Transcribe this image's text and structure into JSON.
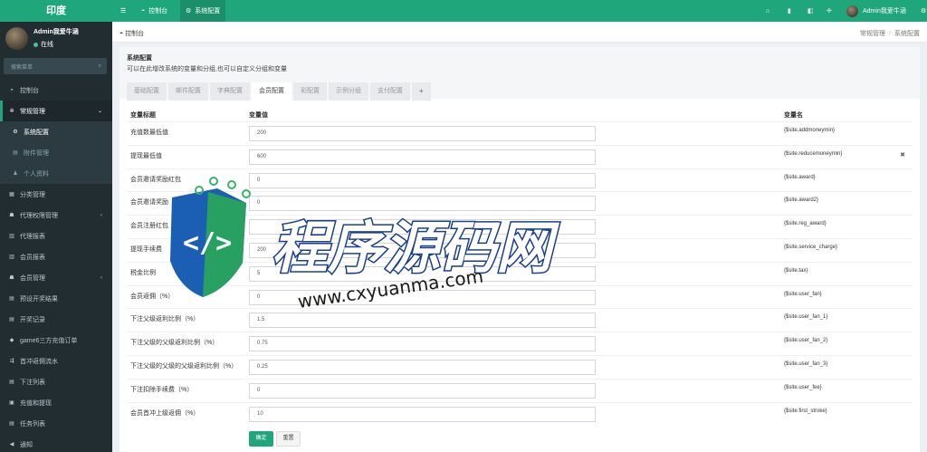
{
  "app": {
    "logo": "印度"
  },
  "user": {
    "name": "Admin我爱牛涵",
    "status": "在线"
  },
  "sidebar": {
    "search_placeholder": "搜索菜单",
    "items": [
      {
        "label": "控制台",
        "icon": "dashboard-icon"
      },
      {
        "label": "常规管理",
        "icon": "cogs-icon"
      },
      {
        "label": "系统配置",
        "icon": "gear-icon"
      },
      {
        "label": "附件管理",
        "icon": "file-icon"
      },
      {
        "label": "个人资料",
        "icon": "user-icon"
      },
      {
        "label": "分类管理",
        "icon": "list-icon"
      },
      {
        "label": "代理权限管理",
        "icon": "group-icon"
      },
      {
        "label": "代理报表",
        "icon": "report-icon"
      },
      {
        "label": "会员报表",
        "icon": "report-icon"
      },
      {
        "label": "会员管理",
        "icon": "users-icon"
      },
      {
        "label": "预设开奖结果",
        "icon": "list-icon"
      },
      {
        "label": "开奖记录",
        "icon": "list-icon"
      },
      {
        "label": "game6三方充值订单",
        "icon": "diamond-icon"
      },
      {
        "label": "首冲返佣流水",
        "icon": "flow-icon"
      },
      {
        "label": "下注列表",
        "icon": "list-icon"
      },
      {
        "label": "充值和提现",
        "icon": "money-icon"
      },
      {
        "label": "任务列表",
        "icon": "list-icon"
      },
      {
        "label": "通知",
        "icon": "bullhorn-icon"
      }
    ]
  },
  "header": {
    "menu_icon": "menu-icon",
    "tabs": [
      {
        "label": "控制台",
        "icon": "dashboard-icon"
      },
      {
        "label": "系统配置",
        "icon": "gear-icon"
      }
    ],
    "user_name": "Admin我爱牛涵"
  },
  "breadcrumb": {
    "left": "控制台",
    "right": [
      "常规管理",
      "系统配置"
    ]
  },
  "panel": {
    "title": "系统配置",
    "description": "可以在此增改系统的变量和分组,也可以自定义分组和变量",
    "tabs": [
      "基础配置",
      "邮件配置",
      "字典配置",
      "会员配置",
      "彩配置",
      "示例分组",
      "支付配置",
      "+"
    ],
    "active_tab": "会员配置",
    "columns": {
      "title": "变量标题",
      "value": "变量值",
      "name": "变量名"
    },
    "rows": [
      {
        "title": "充值数最低值",
        "value": "200",
        "name": "{$site.addmoneymin}"
      },
      {
        "title": "提现最低值",
        "value": "600",
        "name": "{$site.reducemoneymin}",
        "deletable": true
      },
      {
        "title": "会员邀请奖励红包",
        "value": "0",
        "name": "{$site.award}"
      },
      {
        "title": "会员邀请奖励",
        "value": "0",
        "name": "{$site.award2}"
      },
      {
        "title": "会员注册红包",
        "value": "",
        "name": "{$site.reg_award}"
      },
      {
        "title": "提现手续费",
        "value": "200",
        "name": "{$site.service_charge}"
      },
      {
        "title": "税金比例",
        "value": "5",
        "name": "{$site.tax}"
      },
      {
        "title": "会员返佣（%）",
        "value": "0",
        "name": "{$site.user_fan}"
      },
      {
        "title": "下注父级返利比例（%）",
        "value": "1.5",
        "name": "{$site.user_fan_1}"
      },
      {
        "title": "下注父级的父级返利比例（%）",
        "value": "0.75",
        "name": "{$site.user_fan_2}"
      },
      {
        "title": "下注父级的父级的父级返利比例（%）",
        "value": "0.25",
        "name": "{$site.user_fan_3}"
      },
      {
        "title": "下注扣除手续费（%）",
        "value": "0",
        "name": "{$site.user_fee}"
      },
      {
        "title": "会员首冲上级返佣（%）",
        "value": "10",
        "name": "{$site.first_stroke}"
      }
    ],
    "buttons": {
      "ok": "确定",
      "reset": "重置"
    }
  },
  "watermark": {
    "text": "程序源码网",
    "url": "www.cxyuanma.com"
  },
  "colors": {
    "brand": "#1fa67a",
    "sidebar": "#222d32"
  }
}
